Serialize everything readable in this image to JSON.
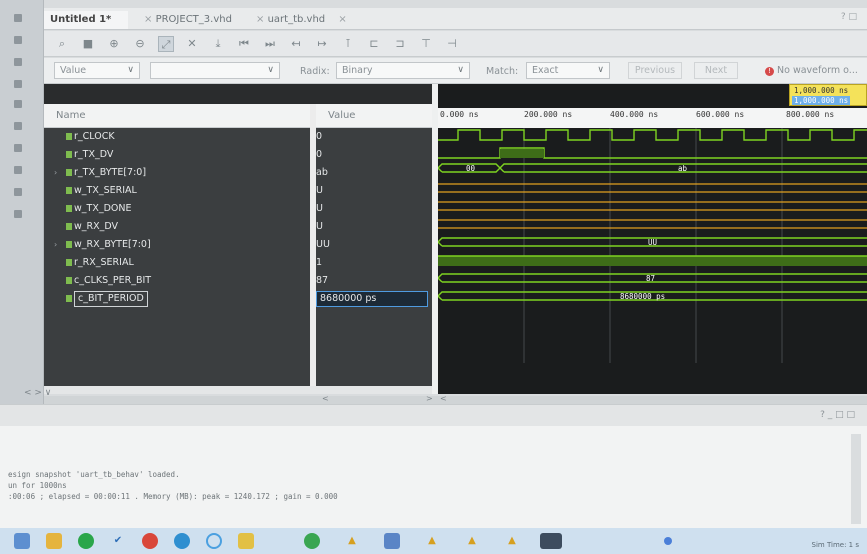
{
  "tabs": [
    {
      "label": "Untitled 1*",
      "active": true
    },
    {
      "label": "PROJECT_3.vhd",
      "active": false
    },
    {
      "label": "uart_tb.vhd",
      "active": false
    }
  ],
  "tab_close": "×",
  "help_glyph": "? □",
  "toolbar_icons": [
    "search-icon",
    "save-icon",
    "zoom-in-icon",
    "zoom-out-icon",
    "zoom-fit-icon",
    "full-view-icon",
    "go-to-cursor-icon",
    "go-to-time-0-icon",
    "go-to-last-time-icon",
    "previous-transition-icon",
    "next-transition-icon",
    "add-marker-icon",
    "previous-marker-icon",
    "next-marker-icon",
    "swap-cursors-icon",
    "cut-icon"
  ],
  "search": {
    "value_field": "Value",
    "value_text": "",
    "radix_label": "Radix:",
    "radix_value": "Binary",
    "match_label": "Match:",
    "match_value": "Exact",
    "previous": "Previous",
    "next": "Next",
    "no_waveform": "No waveform o..."
  },
  "columns": {
    "name": "Name",
    "value": "Value"
  },
  "signals": [
    {
      "name": "r_CLOCK",
      "value": "0"
    },
    {
      "name": "r_TX_DV",
      "value": "0"
    },
    {
      "name": "r_TX_BYTE[7:0]",
      "value": "ab",
      "expand": "›"
    },
    {
      "name": "w_TX_SERIAL",
      "value": "U"
    },
    {
      "name": "w_TX_DONE",
      "value": "U"
    },
    {
      "name": "w_RX_DV",
      "value": "U"
    },
    {
      "name": "w_RX_BYTE[7:0]",
      "value": "UU",
      "expand": "›"
    },
    {
      "name": "r_RX_SERIAL",
      "value": "1"
    },
    {
      "name": "c_CLKS_PER_BIT",
      "value": "87"
    },
    {
      "name": "c_BIT_PERIOD",
      "value": "8680000 ps"
    }
  ],
  "ruler": {
    "ticks": [
      "0.000 ns",
      "200.000 ns",
      "400.000 ns",
      "600.000 ns",
      "800.000 ns"
    ]
  },
  "cursor": {
    "line1": "1,000.000 ns",
    "line2": "1,000.000 ns"
  },
  "bus_labels": {
    "tx_byte_first": "00",
    "tx_byte_second": "ab",
    "rx_byte": "UU",
    "clks_per_bit": "87",
    "bit_period": "8680000 ps"
  },
  "nav_arrows": "< > ∨",
  "scroll_arrows": {
    "left": "<",
    "right": ">",
    "left2": "<"
  },
  "console": {
    "controls": "? _ □ □",
    "lines": [
      "esign snapshot 'uart_tb_behav' loaded.",
      "un for 1000ns",
      ":00:06 ; elapsed = 00:00:11 . Memory (MB): peak = 1240.172 ; gain = 0.000"
    ]
  },
  "taskbar": {
    "icons": [
      "file-explorer-icon",
      "folder-icon",
      "spotify-icon",
      "check-icon",
      "chrome-icon",
      "edge-icon",
      "cortana-icon",
      "notes-icon",
      "torrent-icon",
      "vivado-icon",
      "document-icon",
      "vivado-icon-2",
      "vivado-icon-3",
      "vivado-icon-4",
      "vivado-icon-5",
      "app-icon"
    ],
    "sim_time": "Sim Time: 1 s"
  },
  "colors": {
    "wave_green": "#7ed321",
    "wave_orange": "#e0a020",
    "wave_bg": "#1a1c1d",
    "cursor_yellow": "#f4e25a"
  }
}
